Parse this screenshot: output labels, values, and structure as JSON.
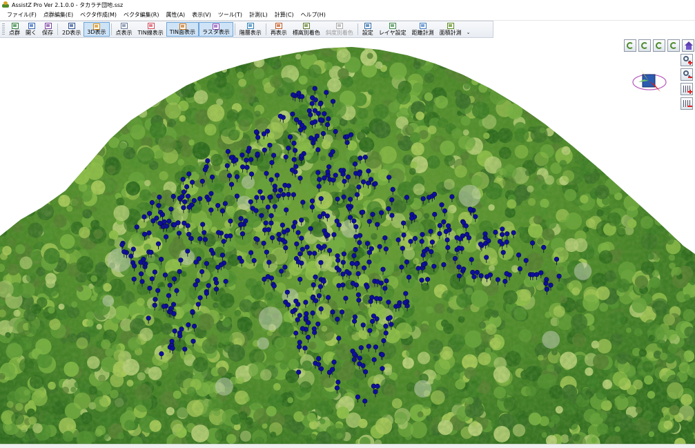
{
  "window": {
    "title": "AssistZ Pro  Ver 2.1.0.0 - タカラチ団地.ssz"
  },
  "menu": [
    {
      "label": "ファイル(F)"
    },
    {
      "label": "点群編集(E)"
    },
    {
      "label": "ベクタ作成(M)"
    },
    {
      "label": "ベクタ編集(R)"
    },
    {
      "label": "属性(A)"
    },
    {
      "label": "表示(V)"
    },
    {
      "label": "ツール(T)"
    },
    {
      "label": "計測(L)"
    },
    {
      "label": "計算(C)"
    },
    {
      "label": "ヘルプ(H)"
    }
  ],
  "toolbar": [
    {
      "label": "点群",
      "icon": "point-cloud-icon",
      "active": false,
      "enabled": true
    },
    {
      "label": "開く",
      "icon": "open-icon",
      "active": false,
      "enabled": true
    },
    {
      "label": "保存",
      "icon": "save-icon",
      "active": false,
      "enabled": true
    },
    {
      "label": "2D表示",
      "icon": "view-2d-icon",
      "active": false,
      "enabled": true
    },
    {
      "label": "3D表示",
      "icon": "view-3d-icon",
      "active": true,
      "enabled": true
    },
    {
      "label": "点表示",
      "icon": "point-display-icon",
      "active": false,
      "enabled": true
    },
    {
      "label": "TIN線表示",
      "icon": "tin-line-icon",
      "active": false,
      "enabled": true
    },
    {
      "label": "TIN面表示",
      "icon": "tin-surface-icon",
      "active": true,
      "enabled": true
    },
    {
      "label": "ラスタ表示",
      "icon": "raster-icon",
      "active": true,
      "enabled": true
    },
    {
      "label": "階層表示",
      "icon": "layer-display-icon",
      "active": false,
      "enabled": true
    },
    {
      "label": "再表示",
      "icon": "redraw-icon",
      "active": false,
      "enabled": true
    },
    {
      "label": "標高別着色",
      "icon": "elevation-color-icon",
      "active": false,
      "enabled": true
    },
    {
      "label": "斜度別着色",
      "icon": "slope-color-icon",
      "active": false,
      "enabled": false
    },
    {
      "label": "設定",
      "icon": "settings-icon",
      "active": false,
      "enabled": true
    },
    {
      "label": "レイヤ設定",
      "icon": "layer-settings-icon",
      "active": false,
      "enabled": true
    },
    {
      "label": "距離計測",
      "icon": "distance-measure-icon",
      "active": false,
      "enabled": true
    },
    {
      "label": "面積計測",
      "icon": "area-measure-icon",
      "active": false,
      "enabled": true
    }
  ],
  "toolbar_overflow": "⌄",
  "colors": {
    "marker": "#0d0f9c",
    "canopy_dark": "#2f6b1f",
    "canopy_light": "#8fbf4a"
  },
  "nav_controls": [
    {
      "icon": "rotate-left-icon"
    },
    {
      "icon": "rotate-down-icon"
    },
    {
      "icon": "rotate-up-icon"
    },
    {
      "icon": "rotate-right-icon"
    },
    {
      "icon": "home-view-icon"
    },
    {
      "icon": "zoom-in-icon"
    },
    {
      "icon": "zoom-out-icon"
    },
    {
      "icon": "point-size-up-icon"
    },
    {
      "icon": "point-size-down-icon"
    }
  ],
  "compass": {
    "icon": "compass-icon"
  }
}
